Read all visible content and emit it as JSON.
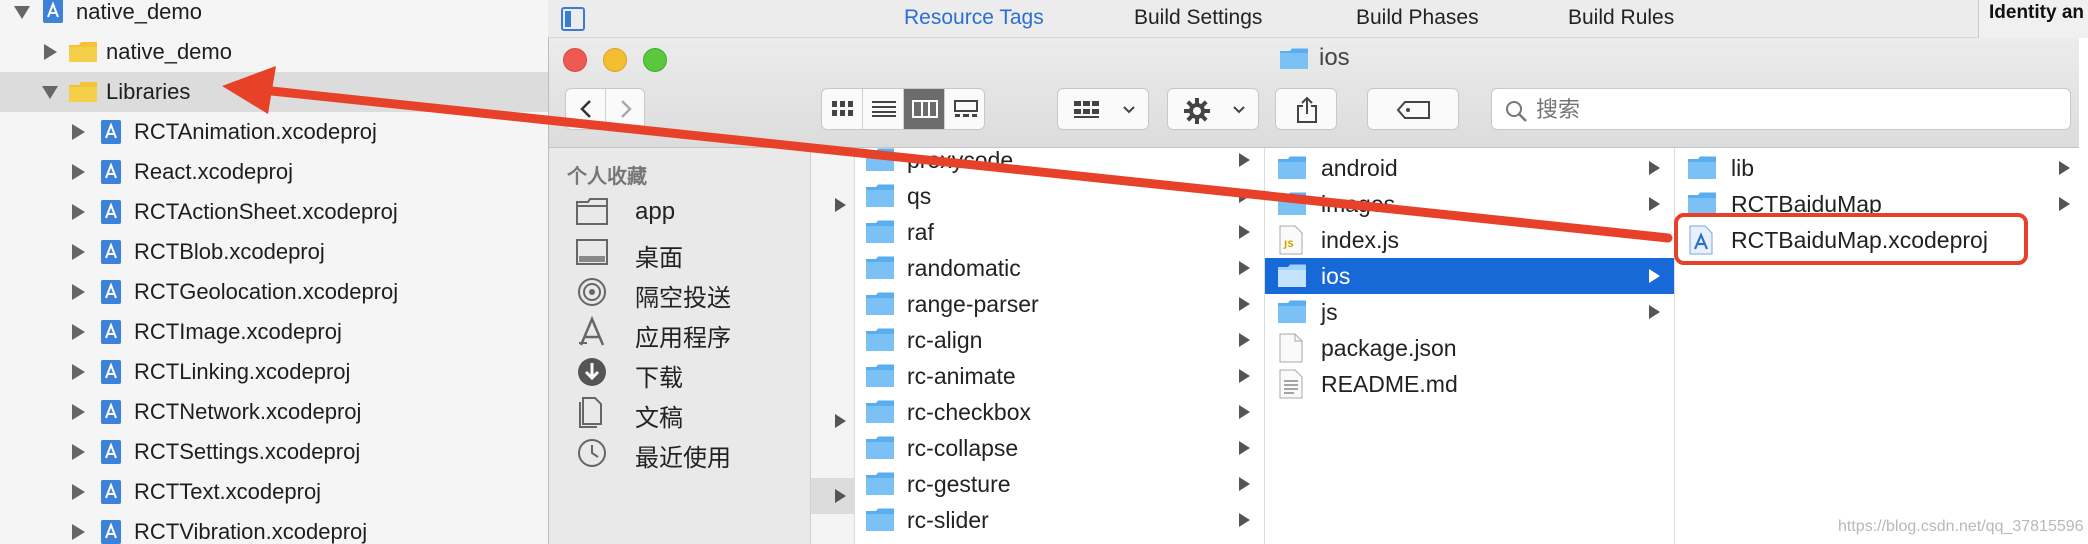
{
  "navigator": {
    "items": [
      {
        "label": "native_demo",
        "expanded": true
      },
      {
        "label": "native_demo",
        "expanded": false
      },
      {
        "label": "Libraries",
        "expanded": true,
        "selected": true
      },
      {
        "label": "RCTAnimation.xcodeproj"
      },
      {
        "label": "React.xcodeproj"
      },
      {
        "label": "RCTActionSheet.xcodeproj"
      },
      {
        "label": "RCTBlob.xcodeproj"
      },
      {
        "label": "RCTGeolocation.xcodeproj"
      },
      {
        "label": "RCTImage.xcodeproj"
      },
      {
        "label": "RCTLinking.xcodeproj"
      },
      {
        "label": "RCTNetwork.xcodeproj"
      },
      {
        "label": "RCTSettings.xcodeproj"
      },
      {
        "label": "RCTText.xcodeproj"
      },
      {
        "label": "RCTVibration.xcodeproj"
      }
    ]
  },
  "editor_tabs": [
    {
      "label": "Resource Tags",
      "active": true
    },
    {
      "label": "Build Settings",
      "active": false
    },
    {
      "label": "Build Phases",
      "active": false
    },
    {
      "label": "Build Rules",
      "active": false
    }
  ],
  "inspector": {
    "title": "Identity an"
  },
  "finder": {
    "window_title": "ios",
    "search_placeholder": "搜索",
    "sidebar": {
      "header": "个人收藏",
      "items": [
        {
          "label": "app",
          "icon": "folder-icon"
        },
        {
          "label": "桌面",
          "icon": "desktop-icon"
        },
        {
          "label": "隔空投送",
          "icon": "airdrop-icon"
        },
        {
          "label": "应用程序",
          "icon": "applications-icon"
        },
        {
          "label": "下载",
          "icon": "downloads-icon"
        },
        {
          "label": "文稿",
          "icon": "documents-icon"
        },
        {
          "label": "最近使用",
          "icon": "recents-icon"
        }
      ]
    },
    "column1": [
      {
        "label": "proxycode"
      },
      {
        "label": "qs"
      },
      {
        "label": "raf"
      },
      {
        "label": "randomatic"
      },
      {
        "label": "range-parser"
      },
      {
        "label": "rc-align"
      },
      {
        "label": "rc-animate"
      },
      {
        "label": "rc-checkbox"
      },
      {
        "label": "rc-collapse"
      },
      {
        "label": "rc-gesture"
      },
      {
        "label": "rc-slider"
      }
    ],
    "column2": [
      {
        "label": "android",
        "type": "folder"
      },
      {
        "label": "images",
        "type": "folder"
      },
      {
        "label": "index.js",
        "type": "js"
      },
      {
        "label": "ios",
        "type": "folder",
        "selected": true
      },
      {
        "label": "js",
        "type": "folder"
      },
      {
        "label": "package.json",
        "type": "file"
      },
      {
        "label": "README.md",
        "type": "text"
      }
    ],
    "column3": [
      {
        "label": "lib",
        "type": "folder"
      },
      {
        "label": "RCTBaiduMap",
        "type": "folder"
      },
      {
        "label": "RCTBaiduMap.xcodeproj",
        "type": "xcodeproj",
        "highlighted": true
      }
    ]
  },
  "colors": {
    "accent": "#1769d8",
    "annotation": "#e8412a",
    "tab_active": "#2a6fd6"
  },
  "watermark": "https://blog.csdn.net/qq_37815596"
}
